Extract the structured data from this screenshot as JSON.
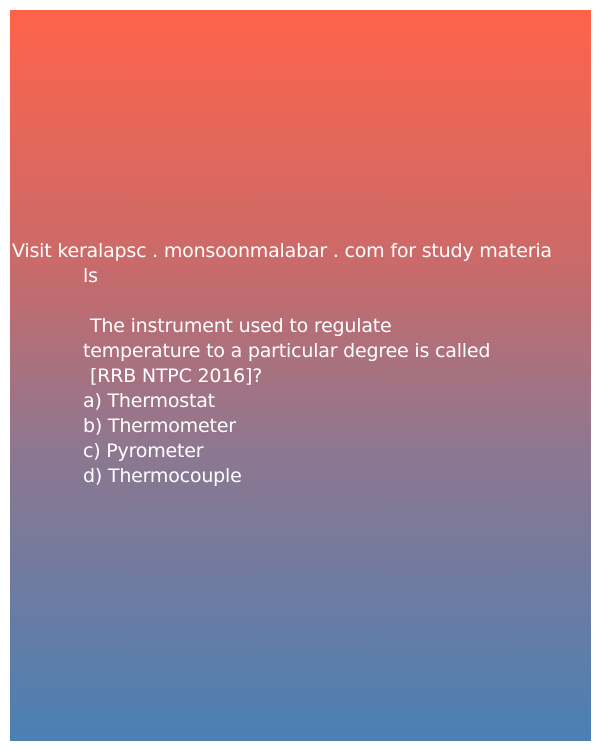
{
  "promo": {
    "line1": "Visit keralapsc . monsoonmalabar . com for study materia",
    "line2": "ls"
  },
  "question": {
    "line1": "The instrument used to regulate",
    "line2": "temperature to a particular degree is called",
    "line3": "[RRB NTPC 2016]?"
  },
  "options": {
    "a": "a) Thermostat",
    "b": "b) Thermometer",
    "c": "c) Pyrometer",
    "d": "d) Thermocouple"
  },
  "colors": {
    "gradient_top": "#ff634a",
    "gradient_bottom": "#4a80b4",
    "text": "#ffffff"
  }
}
